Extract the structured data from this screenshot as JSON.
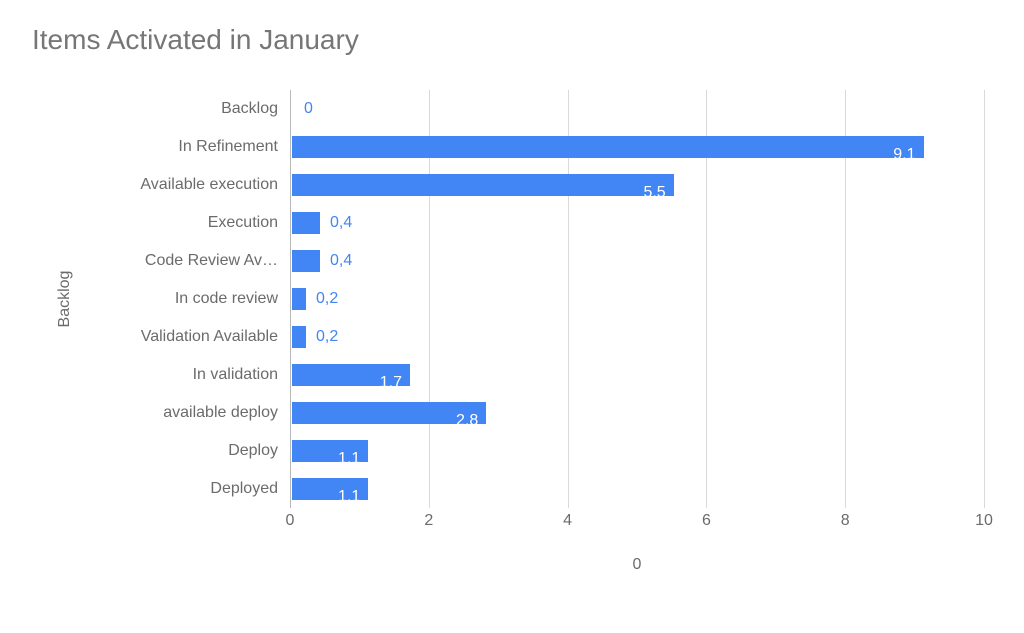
{
  "chart_data": {
    "type": "bar",
    "orientation": "horizontal",
    "title": "Items Activated in January",
    "xlabel": "0",
    "ylabel": "Backlog",
    "xlim": [
      0,
      10
    ],
    "x_ticks": [
      0,
      2,
      4,
      6,
      8,
      10
    ],
    "categories": [
      "Backlog",
      "In Refinement",
      "Available execution",
      "Execution",
      "Code Review Av…",
      "In code review",
      "Validation Available",
      "In validation",
      "available deploy",
      "Deploy",
      "Deployed"
    ],
    "values": [
      0,
      9.1,
      5.5,
      0.4,
      0.4,
      0.2,
      0.2,
      1.7,
      2.8,
      1.1,
      1.1
    ],
    "value_labels": [
      "0",
      "9,1",
      "5,5",
      "0,4",
      "0,4",
      "0,2",
      "0,2",
      "1,7",
      "2,8",
      "1,1",
      "1,1"
    ]
  },
  "style": {
    "bar_color": "#4285f4"
  }
}
